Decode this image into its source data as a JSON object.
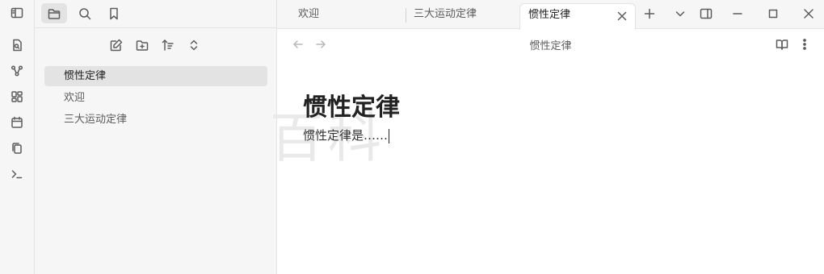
{
  "sidebar": {
    "files": [
      {
        "label": "惯性定律",
        "active": true
      },
      {
        "label": "欢迎",
        "active": false
      },
      {
        "label": "三大运动定律",
        "active": false
      }
    ]
  },
  "tabs": [
    {
      "label": "欢迎"
    },
    {
      "label": "三大运动定律"
    },
    {
      "label": "惯性定律",
      "active": true
    }
  ],
  "view": {
    "title": "惯性定律"
  },
  "document": {
    "heading": "惯性定律",
    "body": "惯性定律是……"
  },
  "watermark": "百科"
}
